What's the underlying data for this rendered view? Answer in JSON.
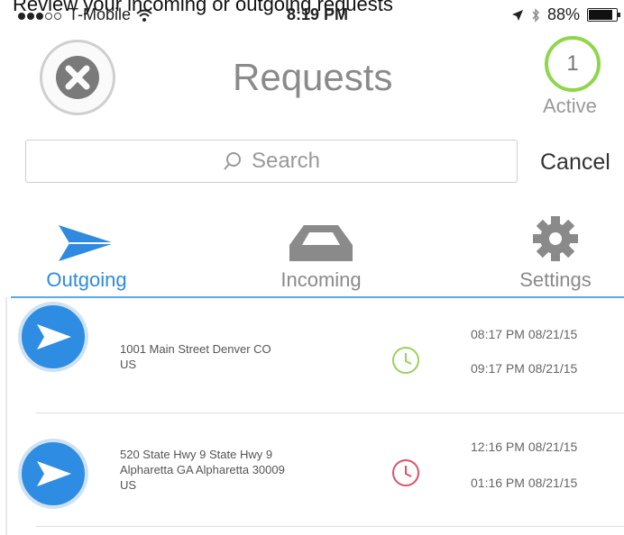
{
  "caption": "Review your incoming or outgoing requests",
  "status_bar": {
    "carrier": "T-Mobile",
    "time": "8:19 PM",
    "battery": "88%",
    "signal_icon": "signal-dots-icon",
    "wifi_icon": "wifi-icon",
    "location_icon": "location-arrow-icon",
    "bluetooth_icon": "bluetooth-icon",
    "battery_icon": "battery-icon"
  },
  "header": {
    "title": "Requests",
    "close_icon": "close-icon",
    "active_count": "1",
    "active_label": "Active"
  },
  "search": {
    "placeholder": "Search",
    "cancel_label": "Cancel"
  },
  "tabs": [
    {
      "label": "Outgoing",
      "icon": "send-icon",
      "selected": true
    },
    {
      "label": "Incoming",
      "icon": "inbox-icon",
      "selected": false
    },
    {
      "label": "Settings",
      "icon": "gear-icon",
      "selected": false
    }
  ],
  "colors": {
    "accent": "#2f8ae0",
    "active_green": "#8ed64a",
    "clock_green": "#9bd15a",
    "clock_red": "#e0506a"
  },
  "requests": [
    {
      "address_line1": "1001 Main Street Denver CO",
      "address_line2": "US",
      "address_line3": "",
      "start": "08:17 PM 08/21/15",
      "end": "09:17 PM 08/21/15",
      "status_color": "green"
    },
    {
      "address_line1": "520 State Hwy 9 State Hwy 9",
      "address_line2": "Alpharetta GA Alpharetta 30009",
      "address_line3": "US",
      "start": "12:16 PM 08/21/15",
      "end": "01:16 PM 08/21/15",
      "status_color": "red"
    }
  ]
}
